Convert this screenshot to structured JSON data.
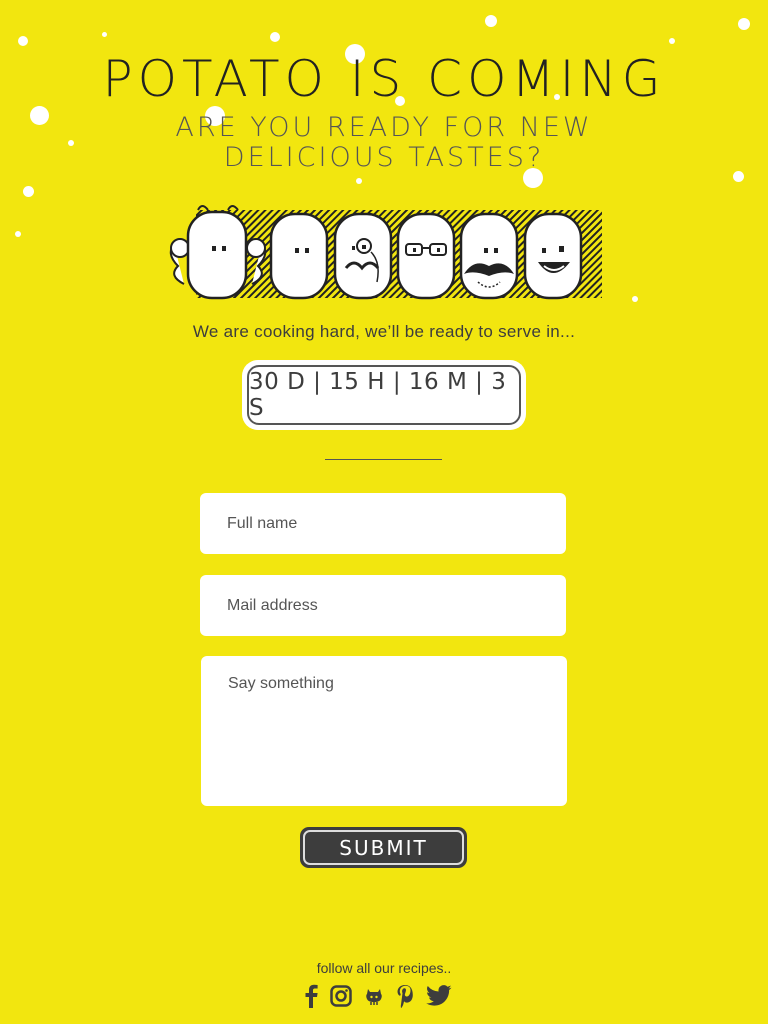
{
  "header": {
    "title": "POTATO IS COMING",
    "subtitle_line1": "ARE YOU READY FOR NEW",
    "subtitle_line2": "DELICIOUS TASTES?"
  },
  "cooking_text": "We are cooking hard, we’ll be ready to serve in...",
  "countdown": {
    "text": "30 D | 15 H | 16 M | 3 S",
    "days": 30,
    "hours": 15,
    "minutes": 16,
    "seconds": 3
  },
  "form": {
    "fullname_placeholder": "Full name",
    "mail_placeholder": "Mail address",
    "message_placeholder": "Say something",
    "submit_label": "SUBMIT"
  },
  "footer": {
    "follow_text": "follow all our recipes..",
    "socials": [
      "facebook-icon",
      "instagram-icon",
      "github-icon",
      "pinterest-icon",
      "twitter-icon"
    ]
  },
  "colors": {
    "background": "#f2e60f",
    "text": "#3d3d3d",
    "button": "#3d3d3d",
    "field": "#ffffff"
  }
}
